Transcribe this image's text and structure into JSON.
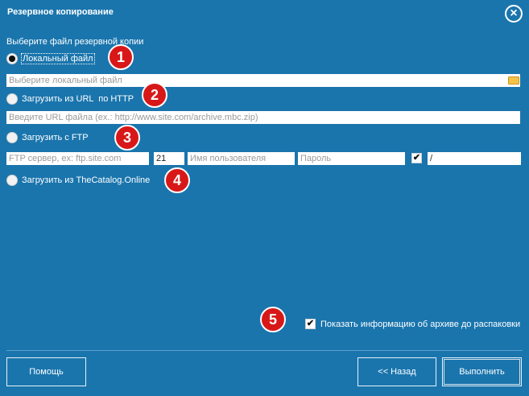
{
  "window": {
    "title": "Резервное копирование",
    "close_icon": "close-icon"
  },
  "prompt": "Выберите файл резервной копии",
  "options": {
    "local": {
      "label": "Локальный файл",
      "selected": true,
      "input_placeholder": "Выберите локальный файл",
      "browse_icon": "folder-icon"
    },
    "url": {
      "label": "Загрузить из URL  по HTTP",
      "selected": false,
      "input_placeholder": "Введите URL файла (ex.: http://www.site.com/archive.mbc.zip)"
    },
    "ftp": {
      "label": "Загрузить с FTP",
      "selected": false,
      "server_placeholder": "FTP сервер, ex: ftp.site.com",
      "port": "21",
      "user_placeholder": "Имя пользователя",
      "password_placeholder": "Пароль",
      "checkbox_checked": true,
      "path": "/"
    },
    "catalog": {
      "label": "Загрузить из TheCatalog.Online",
      "selected": false
    }
  },
  "badges": [
    "1",
    "2",
    "3",
    "4",
    "5"
  ],
  "show_info": {
    "label": "Показать информацию об архиве до распаковки",
    "checked": true
  },
  "buttons": {
    "help": "Помощь",
    "back": "<< Назад",
    "run": "Выполнить"
  },
  "colors": {
    "background": "#1a75ad",
    "badge": "#d81818"
  }
}
